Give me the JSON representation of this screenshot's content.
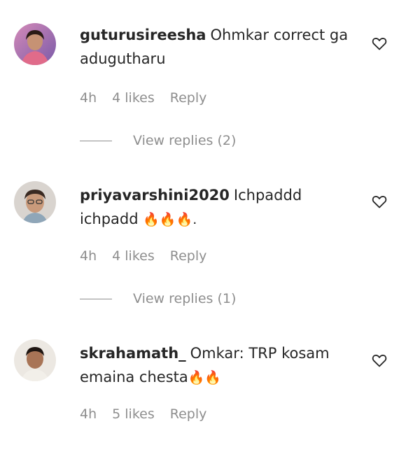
{
  "comments": [
    {
      "username": "guturusireesha",
      "text": "Ohmkar correct ga adugutharu",
      "emoji": "",
      "time": "4h",
      "likes": "4 likes",
      "reply": "Reply",
      "view_replies": "View replies (2)"
    },
    {
      "username": "priyavarshini2020",
      "text": "Ichpaddd ichpadd",
      "emoji": "🔥🔥🔥.",
      "time": "4h",
      "likes": "4 likes",
      "reply": "Reply",
      "view_replies": "View replies (1)"
    },
    {
      "username": "skrahamath_",
      "text": "Omkar: TRP kosam emaina chesta",
      "emoji": "🔥🔥",
      "time": "4h",
      "likes": "5 likes",
      "reply": "Reply",
      "view_replies": ""
    }
  ],
  "colors": {
    "text": "#262626",
    "secondary": "#8e8e8e"
  },
  "icons": {
    "like": "heart-outline-icon",
    "avatar": "profile-photo"
  }
}
